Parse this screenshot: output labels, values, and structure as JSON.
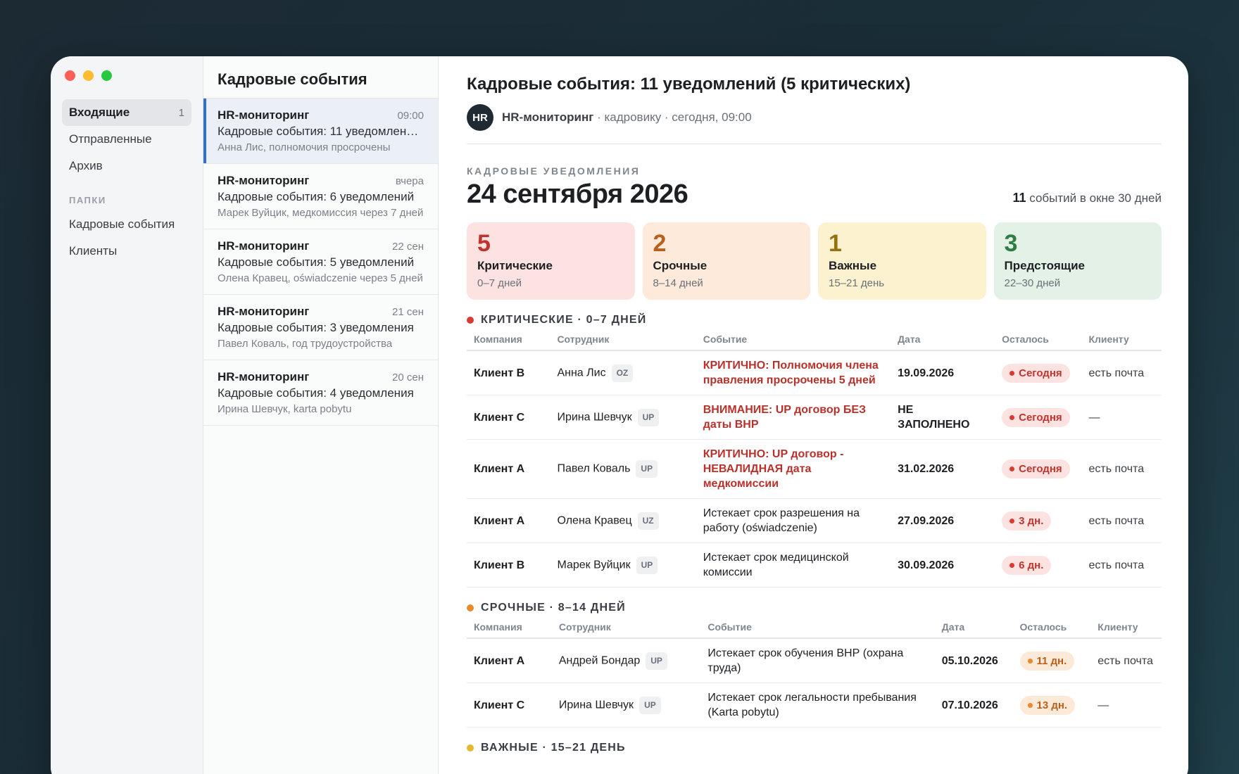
{
  "sidebar": {
    "items": [
      {
        "label": "Входящие",
        "count": "1"
      },
      {
        "label": "Отправленные"
      },
      {
        "label": "Архив"
      }
    ],
    "folders_label": "ПАПКИ",
    "folders": [
      {
        "label": "Кадровые события"
      },
      {
        "label": "Клиенты"
      }
    ]
  },
  "msglist": {
    "title": "Кадровые события",
    "messages": [
      {
        "sender": "HR-мониторинг",
        "time": "09:00",
        "subject": "Кадровые события: 11 уведомлений (5 критических)",
        "preview": "Анна Лис, полномочия просрочены"
      },
      {
        "sender": "HR-мониторинг",
        "time": "вчера",
        "subject": "Кадровые события: 6 уведомлений",
        "preview": "Марек Вуйцик, медкомиссия через 7 дней"
      },
      {
        "sender": "HR-мониторинг",
        "time": "22 сен",
        "subject": "Кадровые события: 5 уведомлений",
        "preview": "Олена Кравец, oświadczenie через 5 дней"
      },
      {
        "sender": "HR-мониторинг",
        "time": "21 сен",
        "subject": "Кадровые события: 3 уведомления",
        "preview": "Павел Коваль, год трудоустройства"
      },
      {
        "sender": "HR-мониторинг",
        "time": "20 сен",
        "subject": "Кадровые события: 4 уведомления",
        "preview": "Ирина Шевчук, karta pobytu"
      }
    ]
  },
  "main": {
    "subject": "Кадровые события: 11 уведомлений (5 критических)",
    "avatar": "HR",
    "from_name": "HR-мониторинг",
    "from_meta": " · кадровику · сегодня, 09:00",
    "eyebrow": "КАДРОВЫЕ УВЕДОМЛЕНИЯ",
    "date": "24 сентября 2026",
    "window_count": "11",
    "window_text": " событий в окне 30 дней",
    "cards": [
      {
        "num": "5",
        "label": "Критические",
        "range": "0–7 дней",
        "bg": "#fde2e2",
        "color": "#c0342c"
      },
      {
        "num": "2",
        "label": "Срочные",
        "range": "8–14 дней",
        "bg": "#fdeadb",
        "color": "#b9601d"
      },
      {
        "num": "1",
        "label": "Важные",
        "range": "15–21 день",
        "bg": "#fcf2cf",
        "color": "#94720f"
      },
      {
        "num": "3",
        "label": "Предстоящие",
        "range": "22–30 дней",
        "bg": "#e3f1e6",
        "color": "#2e7d45"
      }
    ],
    "columns": [
      "Компания",
      "Сотрудник",
      "Событие",
      "Дата",
      "Осталось",
      "Клиенту"
    ],
    "sections": [
      {
        "title": "КРИТИЧЕСКИЕ · 0–7 ДНЕЙ",
        "dot": "#d93a31",
        "rows": [
          {
            "company": "Клиент B",
            "employee": "Анна Лис",
            "tag": "OZ",
            "event": "КРИТИЧНО: Полномочия члена правления просрочены 5 дней",
            "critical": true,
            "date": "19.09.2026",
            "left": "Сегодня",
            "pill": "red",
            "client": "есть почта"
          },
          {
            "company": "Клиент C",
            "employee": "Ирина Шевчук",
            "tag": "UP",
            "event": "ВНИМАНИЕ: UP договор БЕЗ даты ВНР",
            "critical": true,
            "date": "НЕ ЗАПОЛНЕНО",
            "left": "Сегодня",
            "pill": "red",
            "client": "—"
          },
          {
            "company": "Клиент A",
            "employee": "Павел Коваль",
            "tag": "UP",
            "event": "КРИТИЧНО: UP договор - НЕВАЛИДНАЯ дата медкомиссии",
            "critical": true,
            "date": "31.02.2026",
            "left": "Сегодня",
            "pill": "red",
            "client": "есть почта"
          },
          {
            "company": "Клиент A",
            "employee": "Олена Кравец",
            "tag": "UZ",
            "event": "Истекает срок разрешения на работу (oświadczenie)",
            "critical": false,
            "date": "27.09.2026",
            "left": "3 дн.",
            "pill": "red",
            "client": "есть почта"
          },
          {
            "company": "Клиент B",
            "employee": "Марек Вуйцик",
            "tag": "UP",
            "event": "Истекает срок медицинской комиссии",
            "critical": false,
            "date": "30.09.2026",
            "left": "6 дн.",
            "pill": "red",
            "client": "есть почта"
          }
        ]
      },
      {
        "title": "СРОЧНЫЕ · 8–14 ДНЕЙ",
        "dot": "#e98a2c",
        "rows": [
          {
            "company": "Клиент A",
            "employee": "Андрей Бондар",
            "tag": "UP",
            "event": "Истекает срок обучения ВНР (охрана труда)",
            "critical": false,
            "date": "05.10.2026",
            "left": "11 дн.",
            "pill": "orange",
            "client": "есть почта"
          },
          {
            "company": "Клиент C",
            "employee": "Ирина Шевчук",
            "tag": "UP",
            "event": "Истекает срок легальности пребывания (Karta pobytu)",
            "critical": false,
            "date": "07.10.2026",
            "left": "13 дн.",
            "pill": "orange",
            "client": "—"
          }
        ]
      },
      {
        "title": "ВАЖНЫЕ · 15–21 ДЕНЬ",
        "dot": "#e6b82c",
        "rows": []
      }
    ]
  }
}
